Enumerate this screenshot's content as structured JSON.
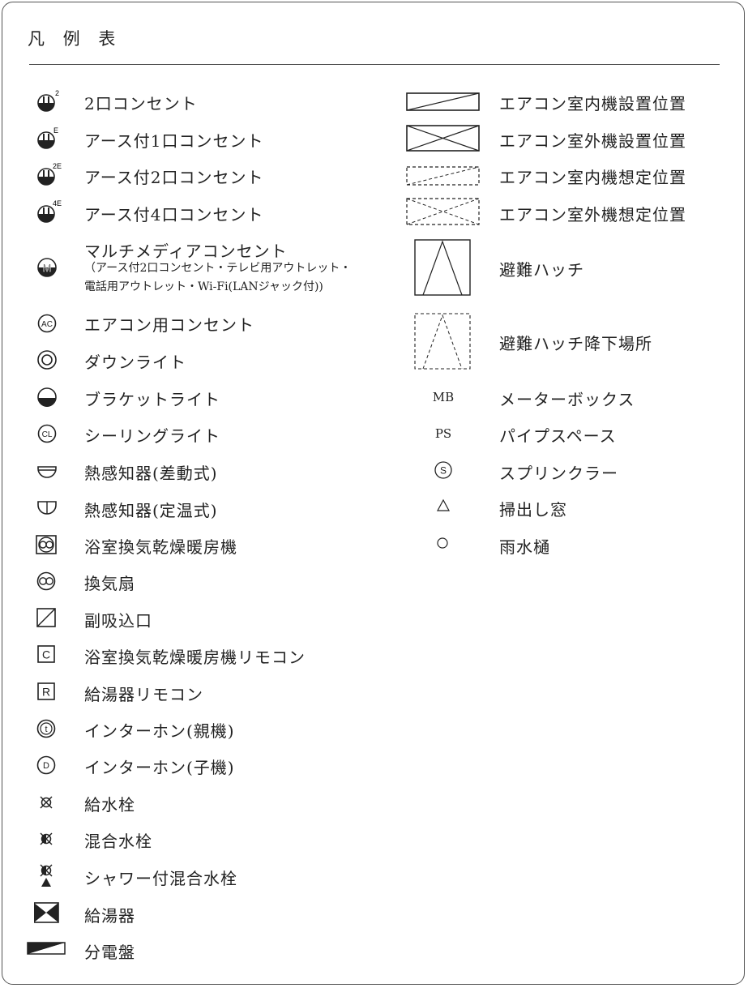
{
  "title": "凡 例 表",
  "left": [
    {
      "icon": "outlet-2-icon",
      "label": "2口コンセント",
      "sup": "2"
    },
    {
      "icon": "outlet-earth-1-icon",
      "label": "アース付1口コンセント",
      "sup": "E"
    },
    {
      "icon": "outlet-earth-2-icon",
      "label": "アース付2口コンセント",
      "sup": "2E"
    },
    {
      "icon": "outlet-earth-4-icon",
      "label": "アース付4口コンセント",
      "sup": "4E"
    },
    {
      "icon": "multimedia-outlet-icon",
      "label": "マルチメディアコンセント",
      "note1": "（アース付2口コンセント・テレビ用アウトレット・",
      "note2": "電話用アウトレット・Wi-Fi(LANジャック付))",
      "letter": "M"
    },
    {
      "icon": "aircon-outlet-icon",
      "label": "エアコン用コンセント",
      "letter": "AC"
    },
    {
      "icon": "downlight-icon",
      "label": "ダウンライト"
    },
    {
      "icon": "bracket-light-icon",
      "label": "ブラケットライト"
    },
    {
      "icon": "ceiling-light-icon",
      "label": "シーリングライト",
      "letter": "CL"
    },
    {
      "icon": "heat-detector-diff-icon",
      "label": "熱感知器(差動式)"
    },
    {
      "icon": "heat-detector-fixed-icon",
      "label": "熱感知器(定温式)"
    },
    {
      "icon": "bath-dryer-icon",
      "label": "浴室換気乾燥暖房機"
    },
    {
      "icon": "ventilation-fan-icon",
      "label": "換気扇"
    },
    {
      "icon": "supply-inlet-icon",
      "label": "副吸込口"
    },
    {
      "icon": "bath-dryer-remote-icon",
      "label": "浴室換気乾燥暖房機リモコン",
      "letter": "C"
    },
    {
      "icon": "water-heater-remote-icon",
      "label": "給湯器リモコン",
      "letter": "R"
    },
    {
      "icon": "intercom-master-icon",
      "label": "インターホン(親機)",
      "letter": "t"
    },
    {
      "icon": "intercom-slave-icon",
      "label": "インターホン(子機)",
      "letter": "D"
    },
    {
      "icon": "water-tap-icon",
      "label": "給水栓"
    },
    {
      "icon": "mixing-tap-icon",
      "label": "混合水栓"
    },
    {
      "icon": "shower-mixing-tap-icon",
      "label": "シャワー付混合水栓"
    },
    {
      "icon": "water-heater-icon",
      "label": "給湯器"
    },
    {
      "icon": "distribution-board-icon",
      "label": "分電盤"
    }
  ],
  "right": [
    {
      "icon": "aircon-indoor-icon",
      "label": "エアコン室内機設置位置"
    },
    {
      "icon": "aircon-outdoor-icon",
      "label": "エアコン室外機設置位置"
    },
    {
      "icon": "aircon-indoor-planned-icon",
      "label": "エアコン室内機想定位置"
    },
    {
      "icon": "aircon-outdoor-planned-icon",
      "label": "エアコン室外機想定位置"
    },
    {
      "icon": "escape-hatch-icon",
      "label": "避難ハッチ"
    },
    {
      "icon": "escape-hatch-landing-icon",
      "label": "避難ハッチ降下場所"
    },
    {
      "icon": "meter-box-icon",
      "label": "メーターボックス",
      "text": "MB"
    },
    {
      "icon": "pipe-space-icon",
      "label": "パイプスペース",
      "text": "PS"
    },
    {
      "icon": "sprinkler-icon",
      "label": "スプリンクラー",
      "letter": "S"
    },
    {
      "icon": "sweep-window-icon",
      "label": "掃出し窓"
    },
    {
      "icon": "rain-gutter-icon",
      "label": "雨水樋"
    }
  ]
}
